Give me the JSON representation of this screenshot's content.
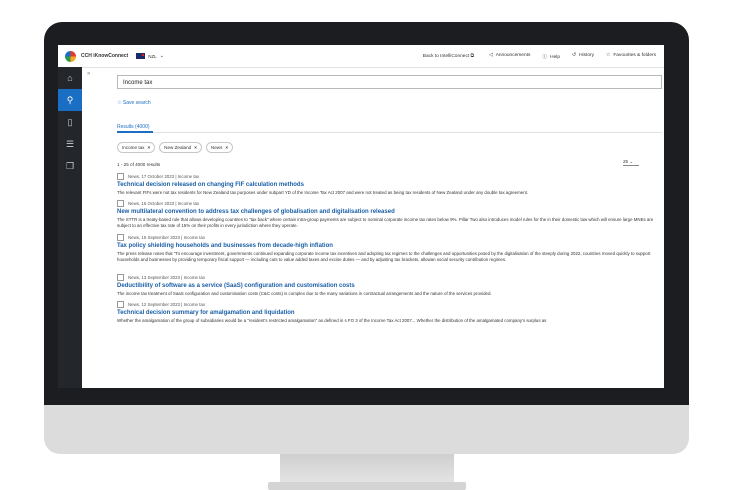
{
  "header": {
    "brand": "CCH iKnowConnect",
    "region": "NZL",
    "links": [
      {
        "label": "Back to IntelliConnect",
        "icon": "external-link-icon"
      },
      {
        "label": "Announcements",
        "icon": "megaphone-icon"
      },
      {
        "label": "Help",
        "icon": "help-icon"
      },
      {
        "label": "History",
        "icon": "history-icon"
      },
      {
        "label": "Favourites & folders",
        "icon": "star-icon"
      }
    ]
  },
  "sidebar": {
    "items": [
      {
        "icon": "home-icon"
      },
      {
        "icon": "search-icon"
      },
      {
        "icon": "document-icon"
      },
      {
        "icon": "list-icon"
      },
      {
        "icon": "book-icon"
      }
    ]
  },
  "search": {
    "query": "Income tax",
    "save_label": "Save search"
  },
  "tabs": {
    "results": "Results (4000)"
  },
  "filters": [
    "Income tax",
    "New Zealand",
    "News"
  ],
  "summary": {
    "count": "1 - 25 of 4000 results",
    "per_page": "25"
  },
  "results": [
    {
      "meta": "News, 17 October 2023 | Income tax",
      "title": "Technical decision released on changing FIF calculation methods",
      "snippet": "The relevant FIFs were not tax residents for New Zealand tax purposes under subpart YD of the Income Tax Act 2007 and were not treated as being tax residents of New Zealand under any double tax agreement."
    },
    {
      "meta": "News, 16 October 2023 | Income tax",
      "title": "New multilateral convention to address tax challenges of globalisation and digitalisation released",
      "snippet": "The STTR is a treaty-based rule that allows developing countries to \"tax back\" where certain intra-group payments are subject to nominal corporate income tax rates below 9%. Pillar Two also introduces model rules for the in their domestic law which will ensure large MNEs are subject to an effective tax rate of 15% on their profits in every jurisdiction where they operate."
    },
    {
      "meta": "News, 15 September 2023 | Income tax",
      "title": "Tax policy shielding households and businesses from decade-high inflation",
      "snippet": "The press release notes that \"To encourage investment, governments continued expanding corporate income tax incentives and adopting tax regimes to the challenges and opportunities posed by the digitalisation of the steeply during 2022, countries moved quickly to support households and businesses by providing temporary fiscal support — including cuts to value added taxes and excise duties — and by adjusting tax brackets, allowan social security contribution regimes."
    },
    {
      "meta": "News, 13 September 2023 | Income tax",
      "title": "Deductibility of software as a service (SaaS) configuration and customisation costs",
      "snippet": "The income tax treatment of SaaS configuration and customisation costs (C&C costs) is complex due to the many variations in contractual arrangements and the nature of the services provided."
    },
    {
      "meta": "News, 12 September 2023 | Income tax",
      "title": "Technical decision summary for amalgamation and liquidation",
      "snippet": "Whether the amalgamation of the group of subsidiaries would be a \"resident's restricted amalgamation\" as defined in s FO 3 of the Income Tax Act 2007... Whether the distribution of the amalgamated company's surplus as"
    }
  ]
}
